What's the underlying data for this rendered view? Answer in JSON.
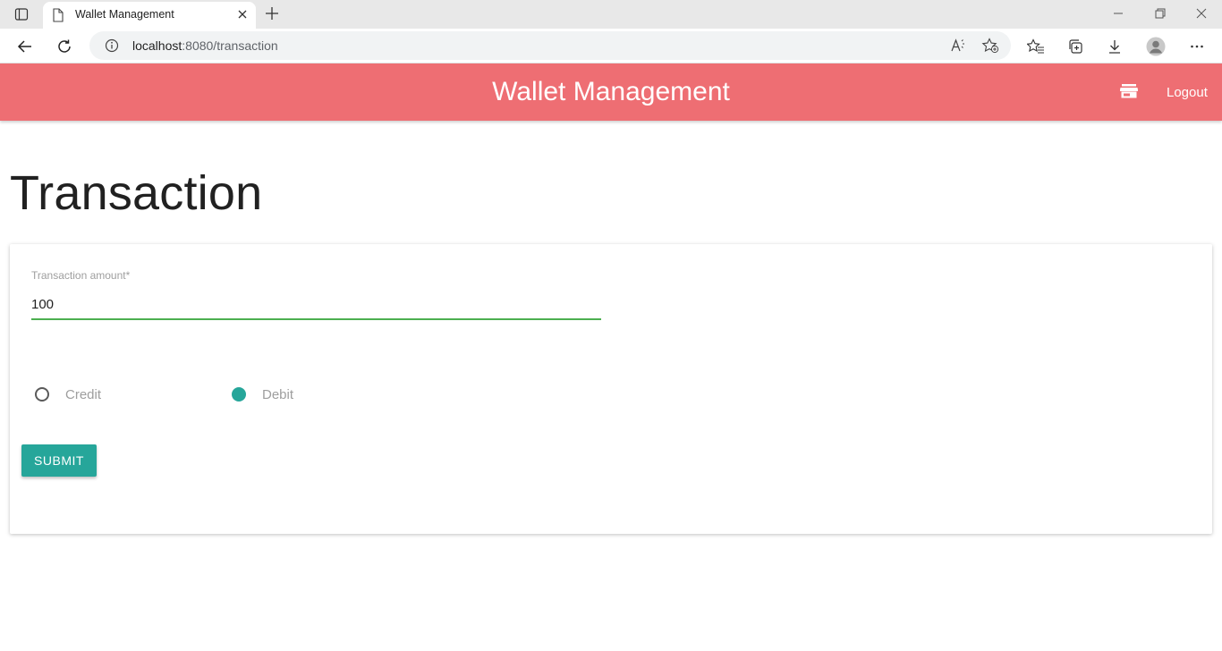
{
  "browser": {
    "tab_title": "Wallet Management",
    "url_host": "localhost",
    "url_rest": ":8080/transaction",
    "icons": {
      "workspaces": "tab-actions-icon",
      "tab_doc": "document-icon",
      "tab_close": "close-icon",
      "new_tab": "plus-icon",
      "back": "back-arrow-icon",
      "refresh": "refresh-icon",
      "site_info": "info-icon",
      "read_aloud": "read-aloud-icon",
      "add_favorite": "add-favorite-icon",
      "favorites": "favorites-icon",
      "collections": "collections-icon",
      "downloads": "download-icon",
      "profile": "profile-avatar-icon",
      "more": "more-icon"
    }
  },
  "header": {
    "title": "Wallet Management",
    "logout_label": "Logout",
    "background": "#ee6e73",
    "icon": "store-icon"
  },
  "page": {
    "title": "Transaction"
  },
  "form": {
    "amount_label": "Transaction amount*",
    "amount_value": "100",
    "options": [
      {
        "label": "Credit",
        "checked": false
      },
      {
        "label": "Debit",
        "checked": true
      }
    ],
    "submit_label": "SUBMIT",
    "accent": "#26a69a",
    "valid_color": "#4caf50"
  }
}
